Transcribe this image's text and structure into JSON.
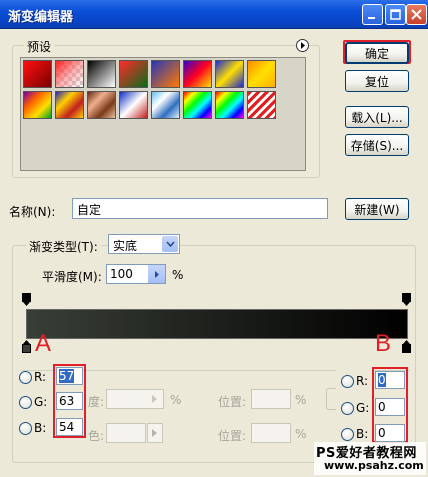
{
  "window": {
    "title": "渐变编辑器"
  },
  "presets": {
    "label": "预设"
  },
  "buttons": {
    "ok": "确定",
    "reset": "复位",
    "load": "载入(L)...",
    "save": "存储(S)...",
    "new": "新建(W)"
  },
  "name": {
    "label": "名称(N):",
    "value": "自定"
  },
  "gradient": {
    "type_label": "渐变类型(T):",
    "type_value": "实底",
    "smoothness_label": "平滑度(M):",
    "smoothness_value": "100",
    "percent": "%"
  },
  "annotations": {
    "left": "A",
    "right": "B"
  },
  "color_left": {
    "r_label": "R:",
    "r": "57",
    "g_label": "G:",
    "g": "63",
    "b_label": "B:",
    "b": "54"
  },
  "color_right": {
    "r_label": "R:",
    "r": "0",
    "g_label": "G:",
    "g": "0",
    "b_label": "B:",
    "b": "0"
  },
  "stops": {
    "location_label": "位置:",
    "percent": "%",
    "opacity_partial": "度:",
    "color_partial": "色:"
  },
  "watermark": {
    "line1": "PS爱好者教程网",
    "line2": "www.psahz.com"
  },
  "colors": {
    "gradient_start": "#393f36",
    "gradient_end": "#000000",
    "annotation": "#e0202a"
  }
}
